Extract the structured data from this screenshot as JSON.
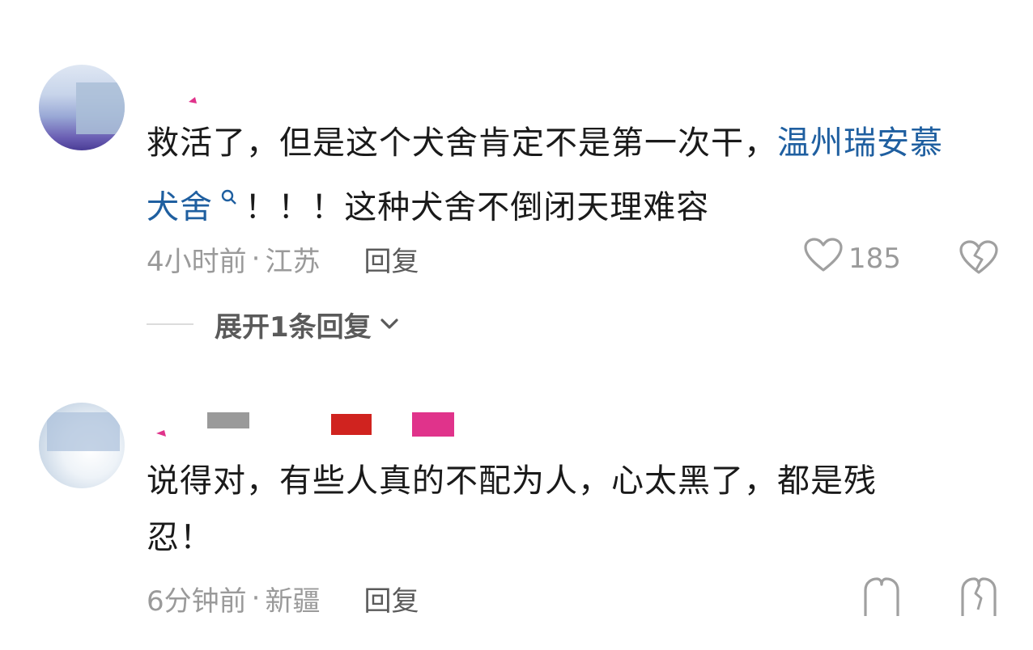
{
  "comments": [
    {
      "text_prefix": "救活了，但是这个犬舍肯定不是第一次干，",
      "link_text": "温州瑞安慕　犬舍",
      "text_suffix": "！！！这种犬舍不倒闭天理难容",
      "time": "4小时前",
      "location": "江苏",
      "reply_label": "回复",
      "likes": "185",
      "expand_label": "展开1条回复"
    },
    {
      "text_line1": "说得对，有些人真的不配为人，心太黑了，都是残",
      "text_line2": "忍！",
      "time": "6分钟前",
      "location": "新疆",
      "reply_label": "回复"
    }
  ],
  "meta_separator": "·",
  "colors": {
    "link": "#1f5fa0",
    "meta": "#9a9a9a",
    "text": "#1a1a1a"
  },
  "icons": [
    "heart-outline-icon",
    "broken-heart-icon",
    "chevron-down-icon",
    "search-icon"
  ]
}
